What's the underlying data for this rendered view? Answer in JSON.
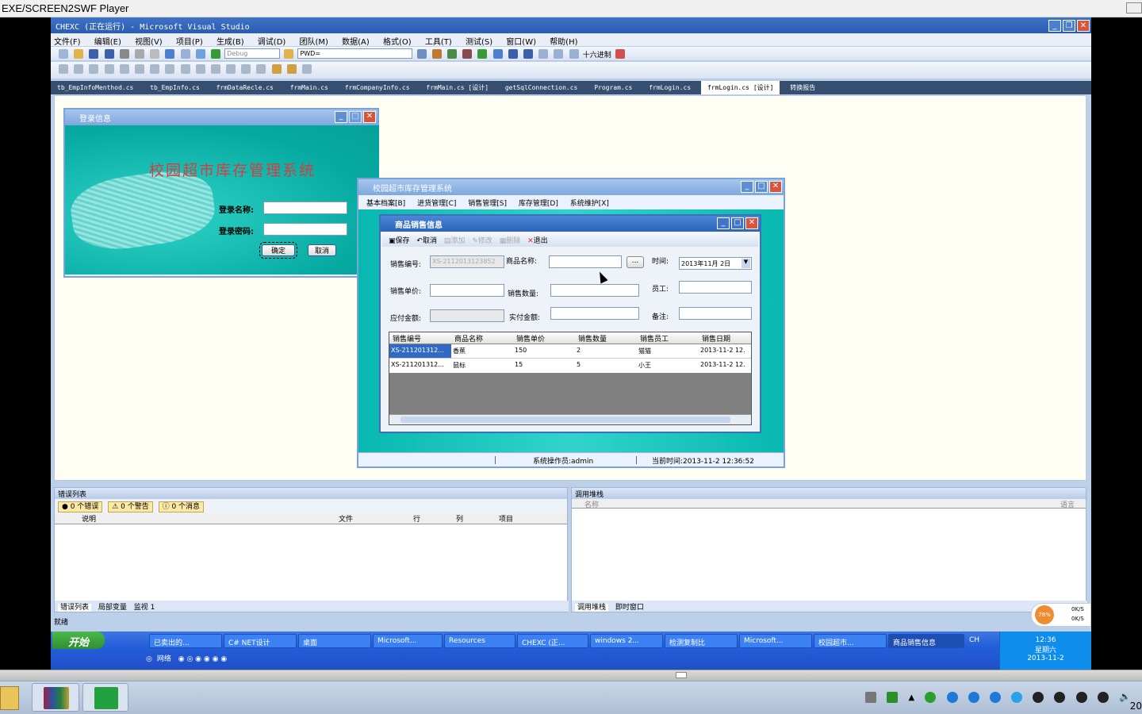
{
  "player": {
    "title": "EXE/SCREEN2SWF Player"
  },
  "vs": {
    "title": "CHEXC (正在运行) - Microsoft Visual Studio",
    "menu": [
      "文件(F)",
      "编辑(E)",
      "视图(V)",
      "项目(P)",
      "生成(B)",
      "调试(D)",
      "团队(M)",
      "数据(A)",
      "格式(O)",
      "工具(T)",
      "测试(S)",
      "窗口(W)",
      "帮助(H)"
    ],
    "config": "Debug",
    "find": "PWD=",
    "hex_label": "十六进制",
    "tabs": [
      "tb_EmpInfoMenthod.cs",
      "tb_EmpInfo.cs",
      "frmDataRecle.cs",
      "frmMain.cs",
      "frmCompanyInfo.cs",
      "frmMain.cs [设计]",
      "getSqlConnection.cs",
      "Program.cs",
      "frmLogin.cs",
      "frmLogin.cs [设计]",
      "转换报告"
    ],
    "status": "就绪"
  },
  "login": {
    "title": "登录信息",
    "banner": "校园超市库存管理系统",
    "name_label": "登录名称:",
    "pwd_label": "登录密码:",
    "ok": "确定",
    "cancel": "取消"
  },
  "main": {
    "title": "校园超市库存管理系统",
    "menu": [
      "基本档案[B]",
      "进货管理[C]",
      "销售管理[S]",
      "库存管理[D]",
      "系统维护[X]"
    ],
    "status_user": "系统操作员:admin",
    "status_time": "当前时间:2013-11-2 12:36:52"
  },
  "sales": {
    "title": "商品销售信息",
    "toolbar": [
      "保存",
      "取消",
      "添加",
      "修改",
      "删除",
      "退出"
    ],
    "labels": {
      "no": "销售编号:",
      "name": "商品名称:",
      "time": "时间:",
      "price": "销售单价:",
      "qty": "销售数量:",
      "emp": "员工:",
      "due": "应付金额:",
      "paid": "实付金额:",
      "note": "备注:"
    },
    "no_value": "XS-2112013123852",
    "date_value": "2013年11月 2日",
    "browse": "...",
    "columns": [
      "销售编号",
      "商品名称",
      "销售单价",
      "销售数量",
      "销售员工",
      "销售日期"
    ],
    "rows": [
      [
        "XS-211201312...",
        "香蕉",
        "150",
        "2",
        "猫猫",
        "2013-11-2 12."
      ],
      [
        "XS-211201312...",
        "鼠标",
        "15",
        "5",
        "小王",
        "2013-11-2 12."
      ]
    ]
  },
  "errors": {
    "title": "错误列表",
    "filters": [
      "0 个错误",
      "0 个警告",
      "0 个消息"
    ],
    "columns": [
      "说明",
      "文件",
      "行",
      "列",
      "项目"
    ],
    "tabs": [
      "错误列表",
      "局部变量",
      "监视 1"
    ]
  },
  "callstack": {
    "title": "调用堆栈",
    "columns": [
      "名称",
      "语言"
    ],
    "tabs": [
      "调用堆栈",
      "即时窗口"
    ]
  },
  "taskbar": {
    "start": "开始",
    "tasks": [
      "已卖出的...",
      "C# NET设计",
      "桌面",
      "Microsoft...",
      "Resources",
      "CHEXC (正...",
      "windows 2...",
      "检测复制比",
      "Microsoft...",
      "校园超市...",
      "商品销售信息"
    ],
    "ql": [
      "网络"
    ],
    "lang": "CH",
    "net_percent": "78%",
    "net_up": "0K/S",
    "net_down": "0K/S",
    "clock": "12:36",
    "weekday": "星期六",
    "date": "2013-11-2"
  },
  "win7": {
    "corner": "20"
  }
}
